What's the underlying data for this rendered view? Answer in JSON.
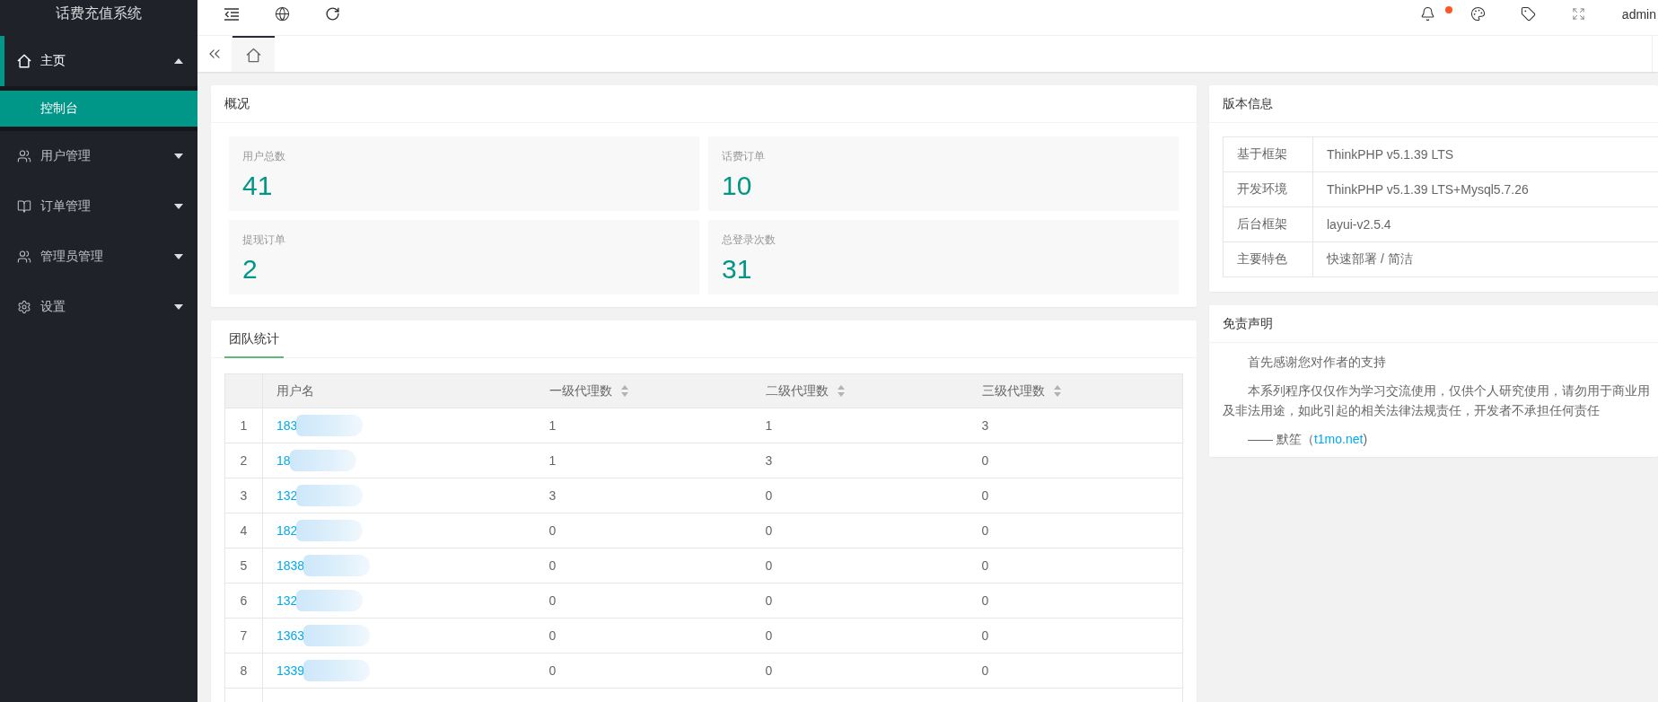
{
  "sidebar": {
    "logo": "话费充值系统",
    "items": [
      {
        "label": "主页",
        "selected": true,
        "expanded": true,
        "children": [
          {
            "label": "控制台",
            "selected": true
          }
        ]
      },
      {
        "label": "用户管理",
        "selected": false,
        "expanded": false
      },
      {
        "label": "订单管理",
        "selected": false,
        "expanded": false
      },
      {
        "label": "管理员管理",
        "selected": false,
        "expanded": false
      },
      {
        "label": "设置",
        "selected": false,
        "expanded": false
      }
    ]
  },
  "header": {
    "notification_unread": true,
    "user": "admin"
  },
  "page_tabs": [
    {
      "selected": true
    }
  ],
  "overview": {
    "title": "概况",
    "stats": [
      {
        "label": "用户总数",
        "value": "41"
      },
      {
        "label": "话费订单",
        "value": "10"
      },
      {
        "label": "提现订单",
        "value": "2"
      },
      {
        "label": "总登录次数",
        "value": "31"
      }
    ]
  },
  "team": {
    "tabs": [
      {
        "label": "团队统计",
        "selected": true
      }
    ],
    "columns": [
      {
        "label": "用户名",
        "sortable": false
      },
      {
        "label": "一级代理数",
        "sortable": true
      },
      {
        "label": "二级代理数",
        "sortable": true
      },
      {
        "label": "三级代理数",
        "sortable": true
      }
    ],
    "rows": [
      {
        "index": "1",
        "username": "183",
        "redacted": true,
        "level_1": "1",
        "level_2": "1",
        "level_3": "3"
      },
      {
        "index": "2",
        "username": "18",
        "redacted": true,
        "level_1": "1",
        "level_2": "3",
        "level_3": "0"
      },
      {
        "index": "3",
        "username": "132",
        "redacted": true,
        "level_1": "3",
        "level_2": "0",
        "level_3": "0"
      },
      {
        "index": "4",
        "username": "182",
        "redacted": true,
        "level_1": "0",
        "level_2": "0",
        "level_3": "0"
      },
      {
        "index": "5",
        "username": "1838",
        "redacted": true,
        "level_1": "0",
        "level_2": "0",
        "level_3": "0"
      },
      {
        "index": "6",
        "username": "132",
        "redacted": true,
        "level_1": "0",
        "level_2": "0",
        "level_3": "0"
      },
      {
        "index": "7",
        "username": "1363",
        "redacted": true,
        "level_1": "0",
        "level_2": "0",
        "level_3": "0"
      },
      {
        "index": "8",
        "username": "1339",
        "redacted": true,
        "level_1": "0",
        "level_2": "0",
        "level_3": "0"
      }
    ]
  },
  "version": {
    "title": "版本信息",
    "rows": [
      {
        "label": "基于框架",
        "value": "ThinkPHP v5.1.39 LTS"
      },
      {
        "label": "开发环境",
        "value": "ThinkPHP v5.1.39 LTS+Mysql5.7.26"
      },
      {
        "label": "后台框架",
        "value": "layui-v2.5.4"
      },
      {
        "label": "主要特色",
        "value": "快速部署 / 简洁"
      }
    ]
  },
  "disclaimer": {
    "title": "免责声明",
    "paragraphs": [
      {
        "lines": [
          "首先感谢您对作者的支持"
        ]
      },
      {
        "lines": [
          "本系列程序仅仅作为学习交流使用，仅供个人研究使用，请勿用于商业用",
          "及非法用途，如此引起的相关法律法规责任，开发者不承担任何责任"
        ]
      }
    ],
    "signature": {
      "before": "—— 默笙（",
      "link": "t1mo.net",
      "after": ")"
    }
  }
}
